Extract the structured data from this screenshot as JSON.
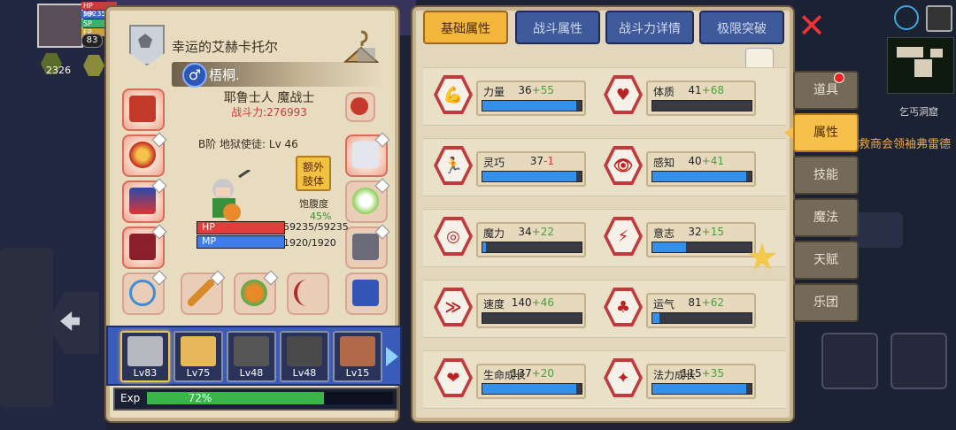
{
  "hud": {
    "avatar_level": "83",
    "gold": "2326",
    "bar_labels": [
      "HP",
      "MP",
      "SP",
      "EP"
    ],
    "hp_number": "59235"
  },
  "character": {
    "title": "幸运的艾赫卡托尔",
    "name": "梧桐.",
    "gender_symbol": "♂",
    "class": "耶鲁士人 魔战士",
    "power": "战斗力:276993",
    "rank": "B阶 地狱使徒: Lv 46",
    "extra_button": "额外\n肢体",
    "hunger_label": "饱腹度",
    "hunger_value": "45%",
    "hp_label": "HP",
    "mp_label": "MP",
    "hp_value": "59235/59235",
    "mp_value": "1920/1920",
    "hp_fraction": 1.0,
    "mp_fraction": 1.0
  },
  "party": [
    {
      "level": "Lv83",
      "active": true
    },
    {
      "level": "Lv75",
      "active": false
    },
    {
      "level": "Lv48",
      "active": false
    },
    {
      "level": "Lv48",
      "active": false
    },
    {
      "level": "Lv15",
      "active": false
    }
  ],
  "exp": {
    "label": "Exp",
    "percent_text": "72%",
    "fraction": 0.72
  },
  "tabs": [
    "基础属性",
    "战斗属性",
    "战斗力详情",
    "极限突破"
  ],
  "stats": [
    {
      "name": "力量",
      "base": "36",
      "bonus": "+55",
      "fill": 0.95,
      "icon": "muscle-icon",
      "glyph": "💪"
    },
    {
      "name": "体质",
      "base": "41",
      "bonus": "+68",
      "fill": 0.0,
      "icon": "body-icon",
      "glyph": "♥"
    },
    {
      "name": "灵巧",
      "base": "37",
      "bonus": "-1",
      "fill": 0.95,
      "icon": "runner-icon",
      "glyph": "🏃"
    },
    {
      "name": "感知",
      "base": "40",
      "bonus": "+41",
      "fill": 0.95,
      "icon": "eye-icon",
      "glyph": "👁"
    },
    {
      "name": "魔力",
      "base": "34",
      "bonus": "+22",
      "fill": 0.04,
      "icon": "spiral-icon",
      "glyph": "◎"
    },
    {
      "name": "意志",
      "base": "32",
      "bonus": "+15",
      "fill": 0.34,
      "icon": "will-icon",
      "glyph": "⚡"
    },
    {
      "name": "速度",
      "base": "140",
      "bonus": "+46",
      "fill": 0.0,
      "icon": "speed-icon",
      "glyph": "≫"
    },
    {
      "name": "运气",
      "base": "81",
      "bonus": "+62",
      "fill": 0.07,
      "icon": "clover-icon",
      "glyph": "♣"
    },
    {
      "name": "生命成长",
      "base": "137",
      "bonus": "+20",
      "fill": 0.95,
      "icon": "heart-growth-icon",
      "glyph": "❤"
    },
    {
      "name": "法力成长",
      "base": "115",
      "bonus": "+35",
      "fill": 0.95,
      "icon": "mana-growth-icon",
      "glyph": "✦"
    }
  ],
  "side_tabs": [
    "道具",
    "属性",
    "技能",
    "魔法",
    "天赋",
    "乐团"
  ],
  "side_active_index": 1,
  "map": {
    "label": "乞丐洞窟",
    "quest": "救商会领袖弗雷德"
  },
  "colors": {
    "accent": "#f3b53a",
    "stat_bar": "#3590ea",
    "hp": "#e23c3c",
    "mp": "#3f7ce8",
    "exp": "#39b54a",
    "close": "#e33333"
  }
}
